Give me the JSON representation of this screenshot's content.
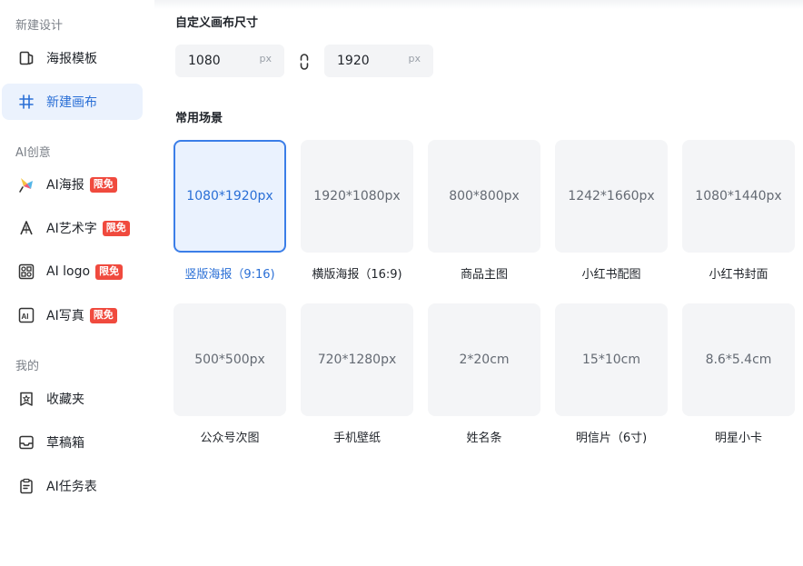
{
  "sidebar": {
    "sections": [
      {
        "title": "新建设计"
      },
      {
        "title": "AI创意"
      },
      {
        "title": "我的"
      }
    ],
    "items": [
      {
        "label": "海报模板",
        "icon": "template-icon"
      },
      {
        "label": "新建画布",
        "icon": "canvas-grid-icon"
      },
      {
        "label": "AI海报",
        "icon": "ai-poster-icon",
        "badge": "限免"
      },
      {
        "label": "AI艺术字",
        "icon": "ai-font-icon",
        "badge": "限免"
      },
      {
        "label": "AI logo",
        "icon": "ai-logo-icon",
        "badge": "限免"
      },
      {
        "label": "AI写真",
        "icon": "ai-portrait-icon",
        "badge": "限免"
      },
      {
        "label": "收藏夹",
        "icon": "favorite-icon"
      },
      {
        "label": "草稿箱",
        "icon": "draft-box-icon"
      },
      {
        "label": "AI任务表",
        "icon": "task-list-icon"
      }
    ]
  },
  "custom_size": {
    "title": "自定义画布尺寸",
    "width": "1080",
    "height": "1920",
    "unit": "px"
  },
  "scenes": {
    "title": "常用场景",
    "cards": [
      {
        "size": "1080*1920px",
        "label": "竖版海报（9:16)",
        "selected": true
      },
      {
        "size": "1920*1080px",
        "label": "横版海报（16:9)"
      },
      {
        "size": "800*800px",
        "label": "商品主图"
      },
      {
        "size": "1242*1660px",
        "label": "小红书配图"
      },
      {
        "size": "1080*1440px",
        "label": "小红书封面"
      },
      {
        "size": "500*500px",
        "label": "公众号次图"
      },
      {
        "size": "720*1280px",
        "label": "手机壁纸"
      },
      {
        "size": "2*20cm",
        "label": "姓名条"
      },
      {
        "size": "15*10cm",
        "label": "明信片（6寸)"
      },
      {
        "size": "8.6*5.4cm",
        "label": "明星小卡"
      }
    ]
  },
  "colors": {
    "accent": "#2a6fd6",
    "badge": "#f04a3e",
    "active_bg": "#ebf2fd"
  }
}
